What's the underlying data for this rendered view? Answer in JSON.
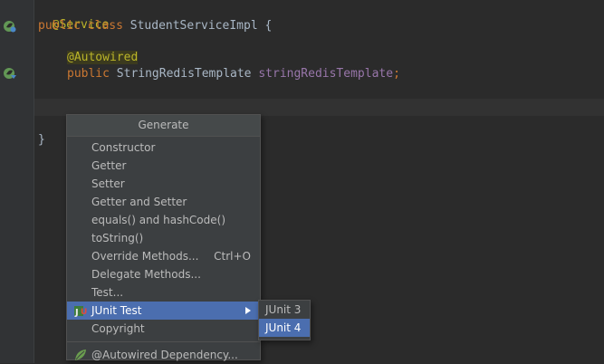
{
  "code": {
    "line1_annotation": "@Service",
    "line2_kw1": "public",
    "line2_kw2": "class",
    "line2_rest": "StudentServiceImpl {",
    "line4_annotation": "@Autowired",
    "line5_kw": "public",
    "line5_type": "StringRedisTemplate",
    "line5_field": "stringRedisTemplate",
    "line5_end": ";",
    "line8_brace": "}"
  },
  "gutter": {
    "icons": [
      "spring-bean-icon",
      "spring-autowired-icon"
    ]
  },
  "generate_menu": {
    "title": "Generate",
    "items": [
      {
        "label": "Constructor"
      },
      {
        "label": "Getter"
      },
      {
        "label": "Setter"
      },
      {
        "label": "Getter and Setter"
      },
      {
        "label": "equals() and hashCode()"
      },
      {
        "label": "toString()"
      },
      {
        "label": "Override Methods...",
        "shortcut": "Ctrl+O"
      },
      {
        "label": "Delegate Methods..."
      },
      {
        "label": "Test..."
      },
      {
        "label": "JUnit Test",
        "selected": true,
        "icon": "junit-icon"
      },
      {
        "label": "Copyright"
      },
      {
        "label": "@Autowired Dependency...",
        "icon": "spring-leaf-icon"
      }
    ]
  },
  "junit_submenu": {
    "items": [
      {
        "label": "JUnit 3"
      },
      {
        "label": "JUnit 4",
        "selected": true
      }
    ]
  },
  "colors": {
    "background": "#2b2b2b",
    "keyword": "#cc7832",
    "annotation": "#bbb529",
    "field": "#9876aa",
    "selection": "#4b6eaf"
  }
}
